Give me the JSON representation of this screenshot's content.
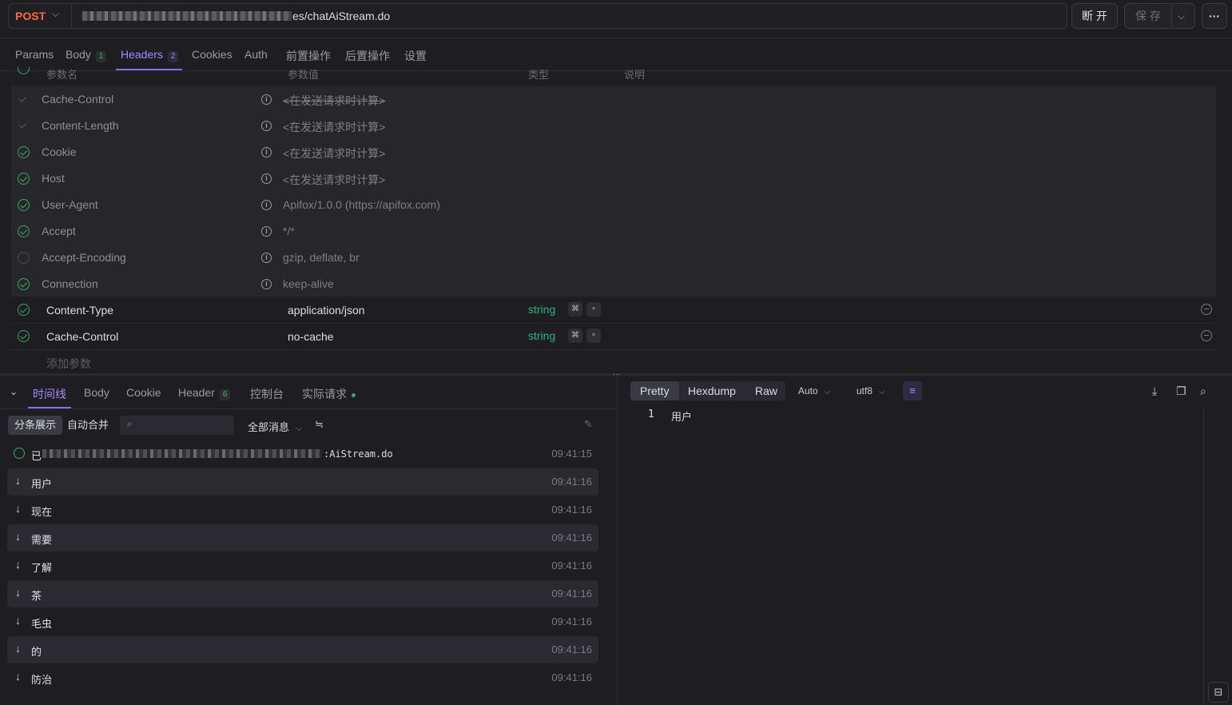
{
  "request": {
    "method": "POST",
    "url_visible": "es/chatAiStream.do",
    "disconnect_label": "断 开",
    "save_label": "保 存"
  },
  "tabs": [
    {
      "label": "Params",
      "badge": ""
    },
    {
      "label": "Body",
      "badge": "1"
    },
    {
      "label": "Headers",
      "badge": "2"
    },
    {
      "label": "Cookies",
      "badge": ""
    },
    {
      "label": "Auth",
      "badge": ""
    },
    {
      "label": "前置操作",
      "badge": ""
    },
    {
      "label": "后置操作",
      "badge": ""
    },
    {
      "label": "设置",
      "badge": ""
    }
  ],
  "columns": [
    "参数名",
    "参数值",
    "类型",
    "说明"
  ],
  "auto_headers": [
    {
      "name": "Cache-Control",
      "value": "<在发送请求时计算>",
      "state": "dim",
      "strike": true
    },
    {
      "name": "Content-Length",
      "value": "<在发送请求时计算>",
      "state": "dim",
      "strike": false
    },
    {
      "name": "Cookie",
      "value": "<在发送请求时计算>",
      "state": "on",
      "strike": false
    },
    {
      "name": "Host",
      "value": "<在发送请求时计算>",
      "state": "on",
      "strike": false
    },
    {
      "name": "User-Agent",
      "value": "Apifox/1.0.0 (https://apifox.com)",
      "state": "on",
      "strike": false
    },
    {
      "name": "Accept",
      "value": "*/*",
      "state": "on",
      "strike": false
    },
    {
      "name": "Accept-Encoding",
      "value": "gzip, deflate, br",
      "state": "off",
      "strike": false
    },
    {
      "name": "Connection",
      "value": "keep-alive",
      "state": "on",
      "strike": false
    }
  ],
  "custom_headers": [
    {
      "name": "Content-Type",
      "value": "application/json",
      "type": "string"
    },
    {
      "name": "Cache-Control",
      "value": "no-cache",
      "type": "string"
    }
  ],
  "add_param_label": "添加参数",
  "bottom_tabs": [
    {
      "label": "时间线",
      "badge": ""
    },
    {
      "label": "Body",
      "badge": ""
    },
    {
      "label": "Cookie",
      "badge": ""
    },
    {
      "label": "Header",
      "badge": "6"
    },
    {
      "label": "控制台",
      "badge": ""
    },
    {
      "label": "实际请求",
      "badge": ""
    }
  ],
  "view_mode": {
    "split": "分条展示",
    "merge": "自动合并"
  },
  "message_filter": "全部消息",
  "connection_event": {
    "text_suffix": ":AiStream.do",
    "prefix": "已",
    "time": "09:41:15"
  },
  "messages": [
    {
      "text": "用户",
      "time": "09:41:16"
    },
    {
      "text": "现在",
      "time": "09:41:16"
    },
    {
      "text": "需要",
      "time": "09:41:16"
    },
    {
      "text": "了解",
      "time": "09:41:16"
    },
    {
      "text": "茶",
      "time": "09:41:16"
    },
    {
      "text": "毛虫",
      "time": "09:41:16"
    },
    {
      "text": "的",
      "time": "09:41:16"
    },
    {
      "text": "防治",
      "time": "09:41:16"
    }
  ],
  "response_view": {
    "tabs": [
      "Pretty",
      "Hexdump",
      "Raw"
    ],
    "format": "Auto",
    "encoding": "utf8",
    "line_number": "1",
    "content": "用户"
  },
  "colors": {
    "accent": "#a78bfa",
    "method": "#ff6a3d",
    "success": "#3aa864",
    "type": "#2fb47c"
  }
}
